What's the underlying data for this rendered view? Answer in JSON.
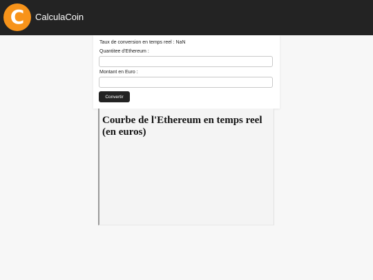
{
  "header": {
    "logo_glyph": "C",
    "logo_color": "#f7931a",
    "title": "CalculaCoin",
    "background": "#232323"
  },
  "converter": {
    "rate_label": "Taux de conversion en temps reel : NaN",
    "ethereum_label": "Quantitee d'Ethereum :",
    "ethereum_value": "",
    "euro_label": "Montant en Euro :",
    "euro_value": "",
    "convert_button": "Convertir"
  },
  "chart": {
    "title": "Courbe de l'Ethereum en temps reel (en euros)"
  }
}
